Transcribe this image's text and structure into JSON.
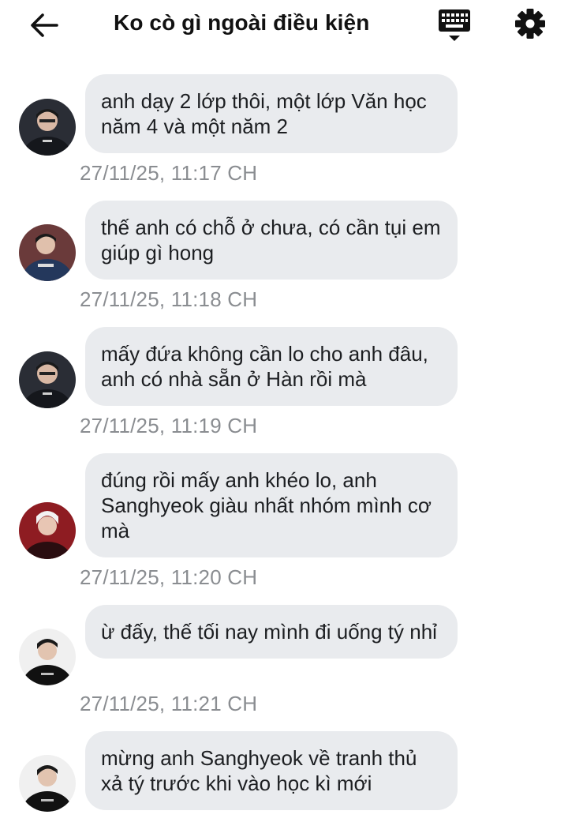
{
  "header": {
    "title": "Ko cò gì ngoài điều kiện",
    "back_icon": "arrow-left-icon",
    "keyboard_icon": "keyboard-icon",
    "settings_icon": "gear-icon"
  },
  "messages": [
    {
      "text": "anh dạy 2 lớp thôi, một lớp Văn học năm 4 và một năm 2",
      "time": "27/11/25, 11:17 CH",
      "avatar_color": "#2a2d35"
    },
    {
      "text": "thế anh có chỗ ở chưa, có cần tụi em giúp gì hong",
      "time": "27/11/25, 11:18 CH",
      "avatar_color": "#24385c"
    },
    {
      "text": "mấy đứa không cần lo cho anh đâu, anh có nhà sẵn ở Hàn rồi mà",
      "time": "27/11/25, 11:19 CH",
      "avatar_color": "#2a2d35"
    },
    {
      "text": "đúng rồi mấy anh khéo lo, anh Sanghyeok giàu nhất nhóm mình cơ mà",
      "time": "27/11/25, 11:20 CH",
      "avatar_color": "#8e1c22"
    },
    {
      "text": "ừ đấy, thế tối nay mình đi uống tý nhỉ",
      "time": "27/11/25, 11:21 CH",
      "avatar_color": "#111111"
    },
    {
      "text": "mừng anh Sanghyeok về tranh thủ xả tý trước khi vào học kì mới",
      "time": "",
      "avatar_color": "#111111"
    }
  ]
}
